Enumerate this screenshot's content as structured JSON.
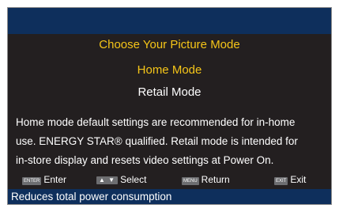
{
  "menu": {
    "title": "Choose Your Picture Mode",
    "options": [
      {
        "label": "Home Mode",
        "selected": true
      },
      {
        "label": "Retail Mode",
        "selected": false
      }
    ]
  },
  "description": {
    "lines": [
      "Home mode default settings are recommended for in-home",
      "use. ENERGY STAR® qualified. Retail mode is intended for",
      "in-store display and resets video settings at Power On."
    ]
  },
  "nav": {
    "enter": {
      "key": "ENTER",
      "label": "Enter"
    },
    "select": {
      "key": "▲ ▼",
      "label": "Select"
    },
    "return": {
      "key": "MENU",
      "label": "Return"
    },
    "exit": {
      "key": "EXIT",
      "label": "Exit"
    }
  },
  "status": {
    "text": "Reduces total power consumption"
  },
  "colors": {
    "background": "#231f20",
    "bar": "#0e2f5c",
    "highlight": "#f5c518",
    "text": "#ffffff"
  }
}
